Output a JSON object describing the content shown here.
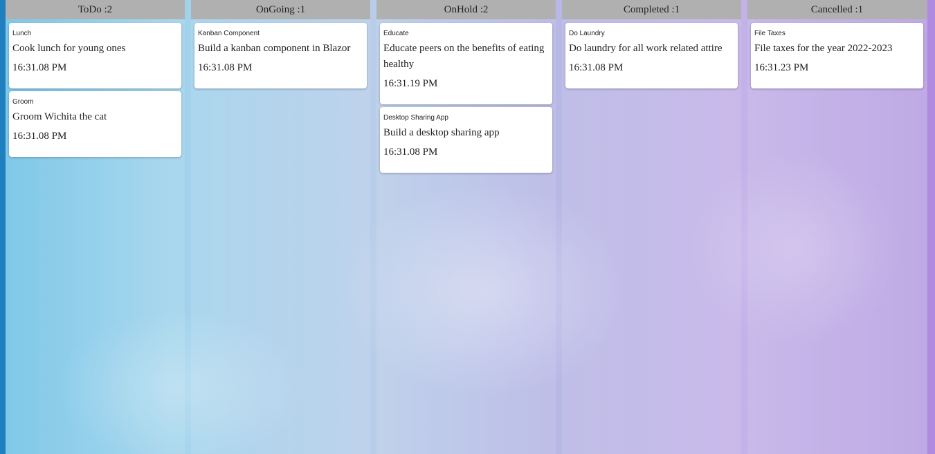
{
  "theme": {
    "header_bg": "#b0b0b0",
    "card_bg": "#ffffff",
    "left_edge": "#1f7fbf",
    "right_edge": "#b08ae0"
  },
  "columns": [
    {
      "header": "ToDo :2",
      "cards": [
        {
          "title": "Lunch",
          "description": "Cook lunch for young ones",
          "time": "16:31.08 PM"
        },
        {
          "title": "Groom",
          "description": "Groom Wichita the cat",
          "time": "16:31.08 PM"
        }
      ]
    },
    {
      "header": "OnGoing :1",
      "cards": [
        {
          "title": "Kanban Component",
          "description": "Build a kanban component in Blazor",
          "time": "16:31.08 PM"
        }
      ]
    },
    {
      "header": "OnHold :2",
      "cards": [
        {
          "title": "Educate",
          "description": "Educate peers on the benefits of eating healthy",
          "time": "16:31.19 PM"
        },
        {
          "title": "Desktop Sharing App",
          "description": "Build a desktop sharing app",
          "time": "16:31.08 PM"
        }
      ]
    },
    {
      "header": "Completed :1",
      "cards": [
        {
          "title": "Do Laundry",
          "description": "Do laundry for all work related attire",
          "time": "16:31.08 PM"
        }
      ]
    },
    {
      "header": "Cancelled :1",
      "cards": [
        {
          "title": "File Taxes",
          "description": "File taxes for the year 2022-2023",
          "time": "16:31.23 PM"
        }
      ]
    }
  ]
}
